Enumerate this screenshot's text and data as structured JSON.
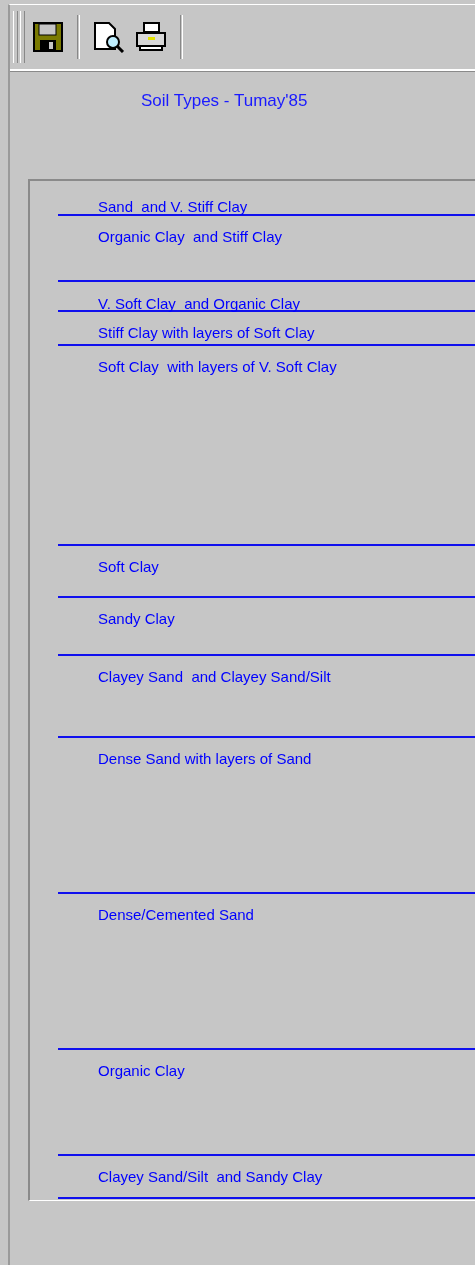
{
  "toolbar": {
    "buttons": [
      {
        "kind": "save"
      },
      {
        "kind": "preview"
      },
      {
        "kind": "print"
      }
    ]
  },
  "title": "Soil Types - Tumay'85",
  "layers": [
    {
      "label": "Sand  and V. Stiff Clay"
    },
    {
      "label": "Organic Clay  and Stiff Clay"
    },
    {
      "label": "V. Soft Clay  and Organic Clay"
    },
    {
      "label": "Stiff Clay with layers of Soft Clay"
    },
    {
      "label": "Soft Clay  with layers of V. Soft Clay"
    },
    {
      "label": "Soft Clay"
    },
    {
      "label": "Sandy Clay"
    },
    {
      "label": "Clayey Sand  and Clayey Sand/Silt"
    },
    {
      "label": "Dense Sand with layers of Sand"
    },
    {
      "label": "Dense/Cemented Sand"
    },
    {
      "label": "Organic Clay"
    },
    {
      "label": "Clayey Sand/Silt  and Sandy Clay"
    }
  ]
}
